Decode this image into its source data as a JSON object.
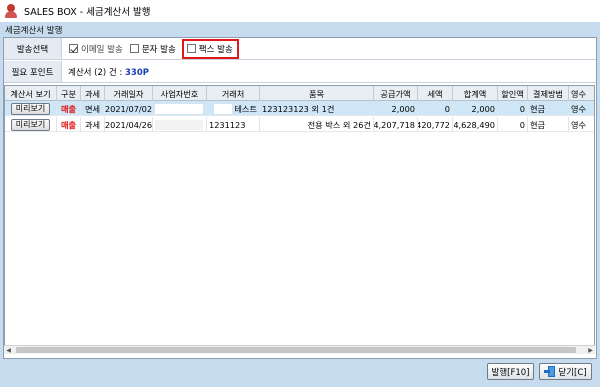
{
  "window": {
    "title": "SALES BOX - 세금계산서 발행"
  },
  "group": {
    "title": "세금계산서 발행"
  },
  "send_options": {
    "label": "발송선택",
    "email": "이메일 발송",
    "sms": "문자 발송",
    "fax": "팩스 발송",
    "email_checked": true,
    "sms_checked": false,
    "fax_checked": false,
    "highlight_color": "#e01818"
  },
  "points": {
    "label": "필요 포인트",
    "text": "계산서 (2) 건 :",
    "amount": "330P"
  },
  "table": {
    "headers": [
      "계산서 보기",
      "구분",
      "과세",
      "거래일자",
      "사업자번호",
      "거래처",
      "품목",
      "공급가액",
      "세액",
      "합계액",
      "할인액",
      "결제방법",
      "영수"
    ],
    "rows": [
      {
        "button": "미리보기",
        "type": "매출",
        "tax": "면세",
        "date": "2021/07/02",
        "bizno": "",
        "client": "테스트",
        "item": "123123123 외 1건",
        "supply": "2,000",
        "vat": "0",
        "total": "2,000",
        "discount": "0",
        "payment": "현금",
        "receipt": "영수"
      },
      {
        "button": "미리보기",
        "type": "매출",
        "tax": "과세",
        "date": "2021/04/26",
        "bizno": "",
        "client": "1231123",
        "item": "전용 박스 외 26건",
        "supply": "4,207,718",
        "vat": "420,772",
        "total": "4,628,490",
        "discount": "0",
        "payment": "현금",
        "receipt": "영수"
      }
    ]
  },
  "buttons": {
    "issue": "발행[F10]",
    "close": "닫기[C]"
  },
  "colors": {
    "accent": "#e01818",
    "frame": "#c6dcee",
    "selected_row": "#cfe6f7",
    "points_amount": "#1a3fb0"
  }
}
